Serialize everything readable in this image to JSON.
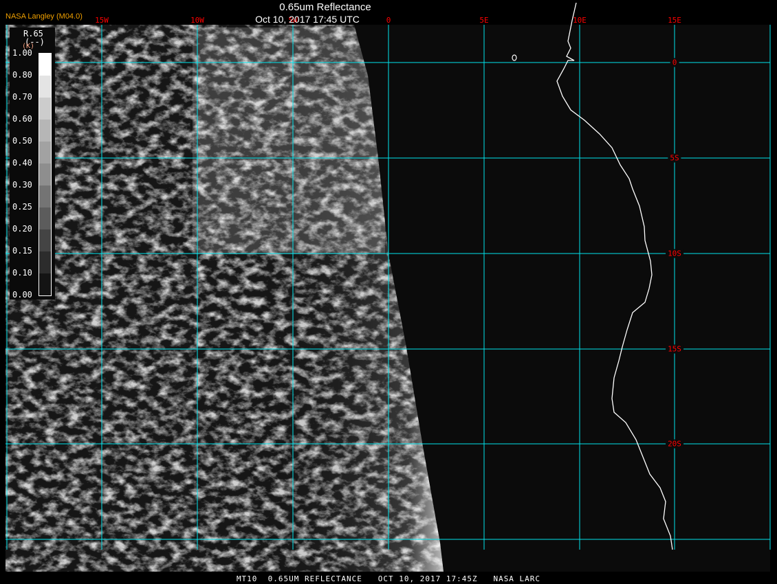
{
  "header": {
    "title": "0.65um Reflectance",
    "datetime": "Oct 10, 2017 17:45 UTC",
    "credit": "NASA Langley (M04.0)"
  },
  "lon_labels": [
    "15W",
    "10W",
    "5W",
    "0",
    "5E",
    "10E",
    "15E"
  ],
  "lat_labels": [
    "0",
    "5S",
    "10S",
    "15S",
    "20S"
  ],
  "legend": {
    "name": "R.65",
    "units": "(--)",
    "k": "(K)",
    "ticks": [
      "1.00",
      "0.80",
      "0.70",
      "0.60",
      "0.50",
      "0.40",
      "0.30",
      "0.25",
      "0.20",
      "0.15",
      "0.10",
      "0.00"
    ],
    "colors": [
      "#ffffff",
      "#e4e4e4",
      "#cccccc",
      "#b6b6b6",
      "#a2a2a2",
      "#8e8e8e",
      "#747474",
      "#5c5c5c",
      "#444444",
      "#2c2c2c",
      "#141414"
    ]
  },
  "footer": "MT10  0.65UM REFLECTANCE   OCT 10, 2017 17:45Z   NASA LARC",
  "colors": {
    "grid": "#00e5ee",
    "label": "#ff0000",
    "coast": "#ffffff",
    "credit": "#f0a000"
  }
}
